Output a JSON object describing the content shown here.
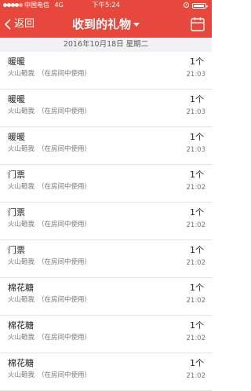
{
  "status_bar": {
    "carrier": "中国电信",
    "network": "4G",
    "time": "下午5:24"
  },
  "nav": {
    "back_label": "返回",
    "title": "收到的礼物",
    "calendar_icon": "calendar-icon",
    "dropdown_icon": "caret-down-icon"
  },
  "date_header": "2016年10月18日  星期二",
  "gifts": [
    {
      "name": "暖暖",
      "sender": "火山砸我",
      "note": "（在房间中使用）",
      "count": "1个",
      "time": "21:03"
    },
    {
      "name": "暖暖",
      "sender": "火山砸我",
      "note": "（在房间中使用）",
      "count": "1个",
      "time": "21:03"
    },
    {
      "name": "暖暖",
      "sender": "火山砸我",
      "note": "（在房间中使用）",
      "count": "1个",
      "time": "21:03"
    },
    {
      "name": "门票",
      "sender": "火山砸我",
      "note": "（在房间中使用）",
      "count": "1个",
      "time": "21:02"
    },
    {
      "name": "门票",
      "sender": "火山砸我",
      "note": "（在房间中使用）",
      "count": "1个",
      "time": "21:02"
    },
    {
      "name": "门票",
      "sender": "火山砸我",
      "note": "（在房间中使用）",
      "count": "1个",
      "time": "21:02"
    },
    {
      "name": "棉花糖",
      "sender": "火山砸我",
      "note": "（在房间中使用）",
      "count": "1个",
      "time": "21:02"
    },
    {
      "name": "棉花糖",
      "sender": "火山砸我",
      "note": "（在房间中使用）",
      "count": "1个",
      "time": "21:02"
    },
    {
      "name": "棉花糖",
      "sender": "火山砸我",
      "note": "（在房间中使用）",
      "count": "1个",
      "time": "21:02"
    }
  ],
  "colors": {
    "brand": "#e8483b",
    "date_bar": "#f2f2f4",
    "divider": "#e3e3e3"
  }
}
